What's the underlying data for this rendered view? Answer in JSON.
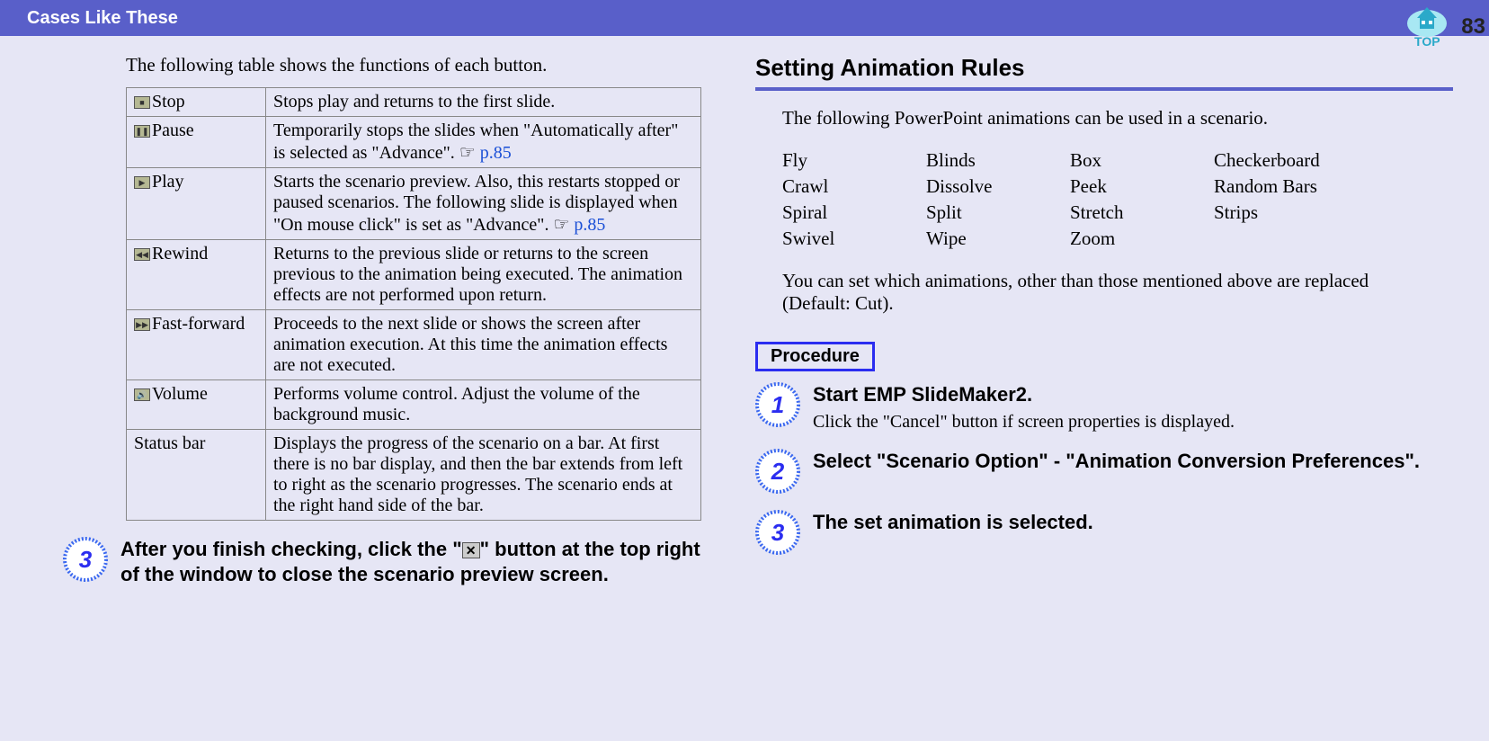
{
  "header": {
    "title": "Cases Like These",
    "top_label": "TOP",
    "page_number": "83"
  },
  "left": {
    "intro": "The following table shows the functions of each button.",
    "rows": [
      {
        "icon": "■",
        "label": "Stop",
        "desc": "Stops play and returns to the first slide."
      },
      {
        "icon": "❚❚",
        "label": "Pause",
        "desc_pre": "Temporarily stops the slides when \"Automatically after\" is selected as \"Advance\". ",
        "link": "p.85"
      },
      {
        "icon": "▶",
        "label": "Play",
        "desc_pre": "Starts the scenario preview. Also, this restarts stopped or paused scenarios. The following slide is displayed when \"On mouse click\" is set as \"Advance\". ",
        "link": "p.85"
      },
      {
        "icon": "◀◀",
        "label": "Rewind",
        "desc": "Returns to the previous slide or returns to the screen previous to the animation being executed. The animation effects are not performed upon return."
      },
      {
        "icon": "▶▶",
        "label": "Fast-forward",
        "desc": "Proceeds to the next slide or shows the screen after animation execution. At this time the animation effects are not executed."
      },
      {
        "icon": "🔊",
        "label": "Volume",
        "desc": "Performs volume control. Adjust the volume of the background music."
      },
      {
        "icon": "",
        "label": "Status bar",
        "desc": "Displays the progress of the scenario on a bar. At first there is no bar display, and then the bar extends from left to right as the scenario progresses. The scenario ends at the right hand side of the bar."
      }
    ],
    "step3_number": "3",
    "step3_pre": "After you finish checking, click the \"",
    "step3_post": "\" button at the top right of the window to close the scenario preview screen."
  },
  "right": {
    "section_title": "Setting Animation Rules",
    "intro": "The following PowerPoint animations can be used in a scenario.",
    "anim_grid": [
      "Fly",
      "Blinds",
      "Box",
      "Checkerboard",
      "Crawl",
      "Dissolve",
      "Peek",
      "Random Bars",
      "Spiral",
      "Split",
      "Stretch",
      "Strips",
      "Swivel",
      "Wipe",
      "Zoom",
      ""
    ],
    "note": "You can set which animations, other than those mentioned above are replaced (Default: Cut).",
    "procedure_label": "Procedure",
    "steps": [
      {
        "n": "1",
        "title": "Start EMP SlideMaker2.",
        "sub": "Click the \"Cancel\" button if screen properties is displayed."
      },
      {
        "n": "2",
        "title": "Select \"Scenario Option\" - \"Animation Conversion Preferences\".",
        "sub": ""
      },
      {
        "n": "3",
        "title": "The set animation is selected.",
        "sub": ""
      }
    ]
  }
}
